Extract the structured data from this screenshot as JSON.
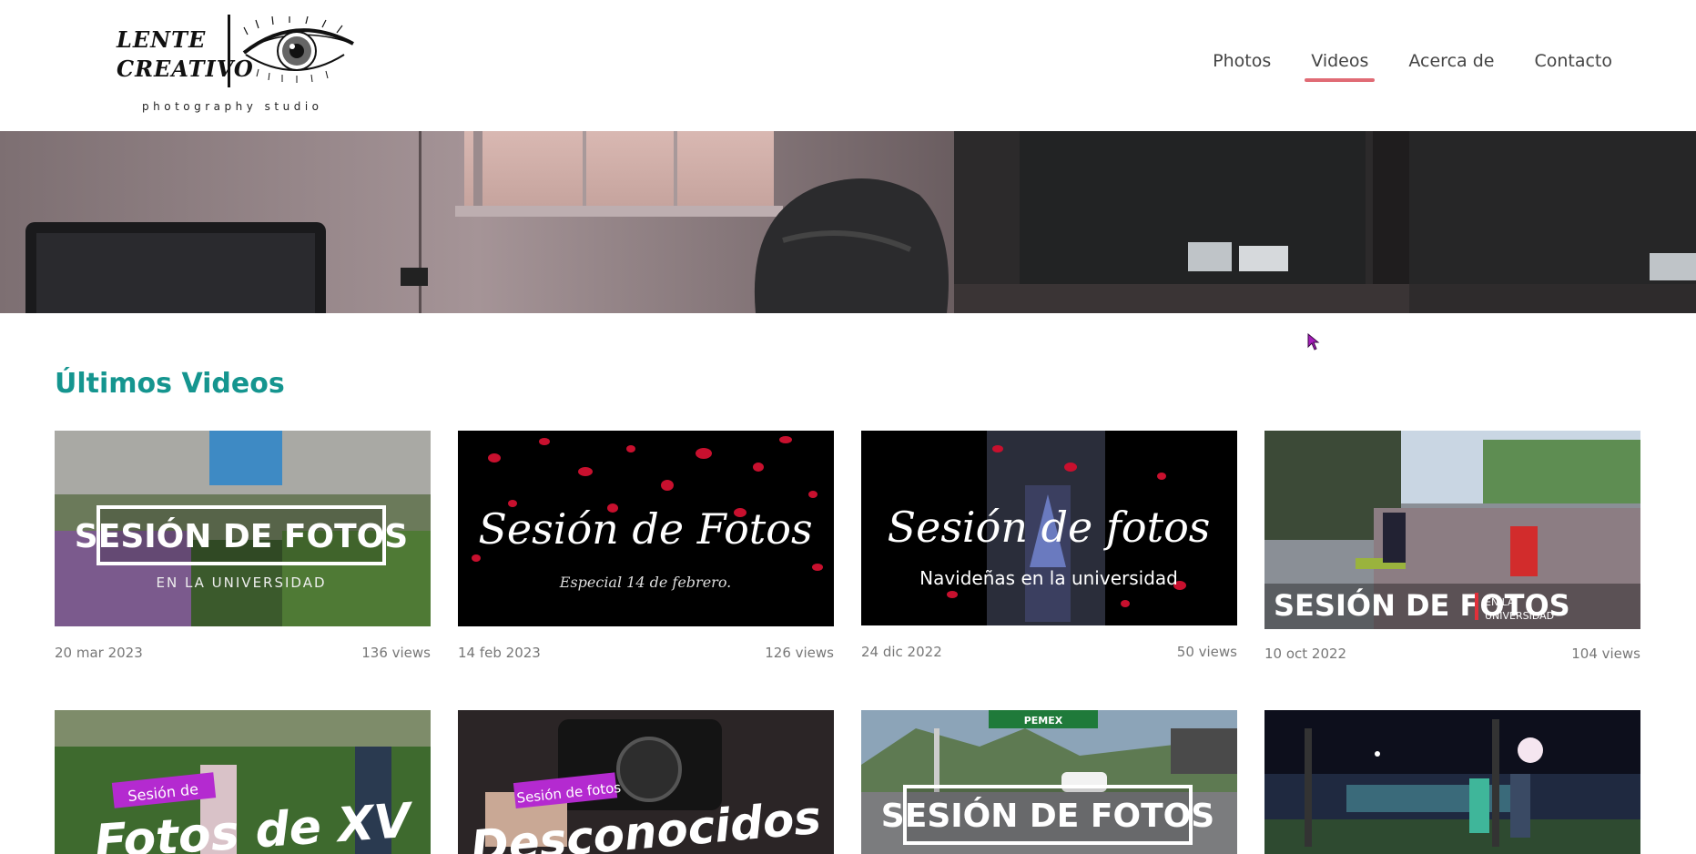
{
  "brand": {
    "line1": "LENTE",
    "line2": "CREATIVO",
    "subtitle": "photography studio"
  },
  "nav": {
    "items": [
      {
        "label": "Photos"
      },
      {
        "label": "Videos",
        "active": true
      },
      {
        "label": "Acerca de"
      },
      {
        "label": "Contacto"
      }
    ]
  },
  "colors": {
    "accent": "#15958f",
    "nav_underline": "#e06b75"
  },
  "section": {
    "title": "Últimos Videos"
  },
  "videos": [
    {
      "title_main": "SESIÓN DE FOTOS",
      "title_sub": "EN LA UNIVERSIDAD",
      "date": "20 mar 2023",
      "views": "136 views"
    },
    {
      "title_main": "Sesión de Fotos",
      "title_sub": "Especial 14 de febrero.",
      "date": "14 feb 2023",
      "views": "126 views"
    },
    {
      "title_main": "Sesión de fotos",
      "title_sub": "Navideñas en la universidad",
      "date": "24 dic 2022",
      "views": "50 views"
    },
    {
      "title_main": "SESIÓN DE FOTOS",
      "title_sub_1": "EN LA",
      "title_sub_2": "UNIVERSIDAD",
      "date": "10 oct 2022",
      "views": "104 views"
    },
    {
      "tag": "Sesión de",
      "title_main": "Fotos de XV"
    },
    {
      "tag": "Sesión de fotos",
      "title_main": "Desconocidos"
    },
    {
      "sign": "PEMEX",
      "title_main": "SESIÓN DE FOTOS"
    },
    {
      "title_main": ""
    }
  ]
}
